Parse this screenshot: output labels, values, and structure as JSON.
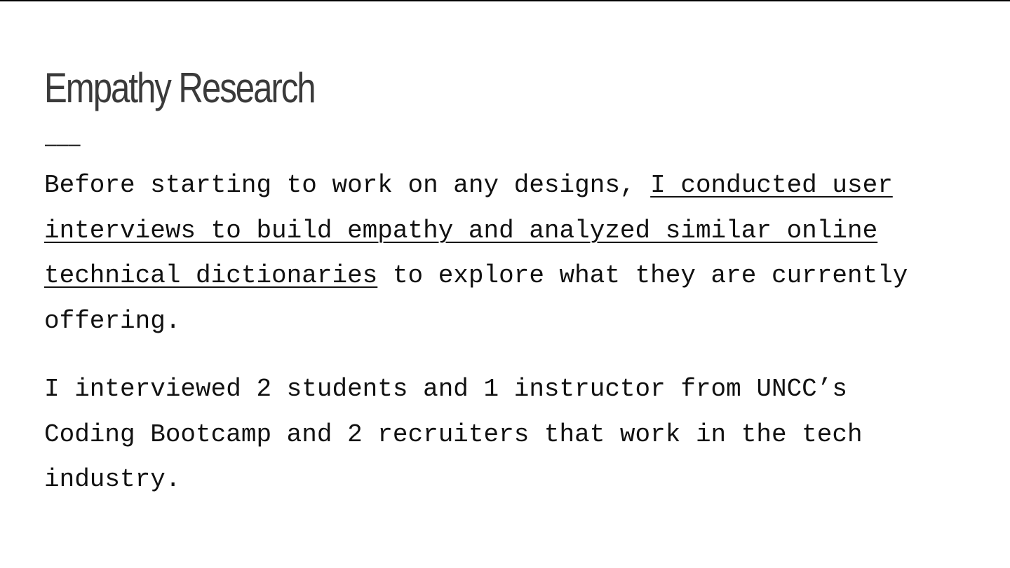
{
  "slide": {
    "title": "Empathy Research",
    "separator": "———",
    "paragraph1": {
      "lead": "Before starting to work on any designs, ",
      "underlined": "I conducted user interviews to build empathy and analyzed similar online technical dictionaries",
      "tail": " to explore what they are currently offering."
    },
    "paragraph2": "I interviewed 2 students and 1 instructor from UNCC’s Coding Bootcamp and 2 recruiters that work in the tech industry."
  }
}
